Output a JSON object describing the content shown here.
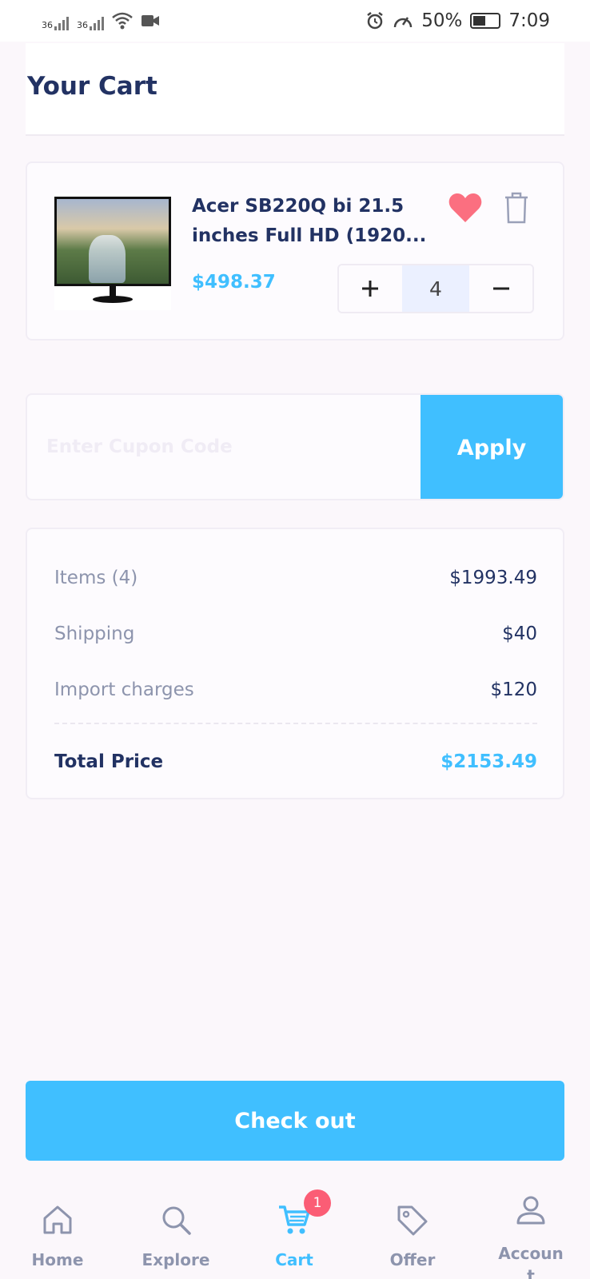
{
  "status_bar": {
    "signal_1": "36",
    "signal_2": "36",
    "battery_percent": "50%",
    "time": "7:09"
  },
  "header": {
    "title": "Your Cart"
  },
  "cart_items": [
    {
      "name": "Acer SB220Q bi 21.5 inches Full HD (1920...",
      "price": "$498.37",
      "quantity": "4",
      "favorited": true
    }
  ],
  "coupon": {
    "placeholder": "Enter Cupon Code",
    "apply_label": "Apply"
  },
  "summary": {
    "items_label": "Items (4)",
    "items_value": "$1993.49",
    "shipping_label": "Shipping",
    "shipping_value": "$40",
    "import_label": "Import charges",
    "import_value": "$120",
    "total_label": "Total Price",
    "total_value": "$2153.49"
  },
  "checkout_label": "Check out",
  "nav": {
    "home": "Home",
    "explore": "Explore",
    "cart": "Cart",
    "cart_badge": "1",
    "offer": "Offer",
    "account": "Account"
  },
  "colors": {
    "accent": "#40bfff",
    "heart": "#fb5d75",
    "text_dark": "#223263",
    "text_muted": "#8d94ad",
    "background": "#fbf7fb"
  },
  "icons": [
    "wifi-icon",
    "video-call-icon",
    "alarm-icon",
    "speed-icon",
    "battery-icon",
    "heart-icon",
    "trash-icon",
    "plus-icon",
    "minus-icon",
    "home-icon",
    "search-icon",
    "cart-icon",
    "tag-icon",
    "user-icon"
  ]
}
